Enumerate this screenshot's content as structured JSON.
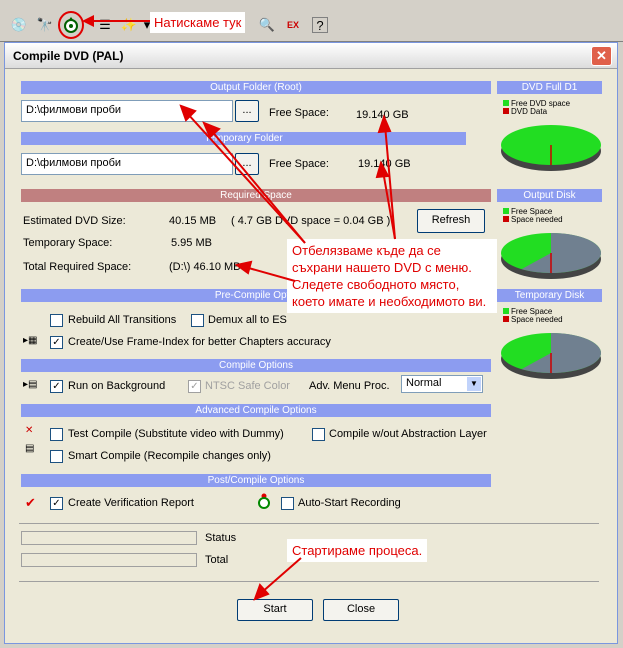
{
  "toolbar": {
    "annotation": "Натискаме тук",
    "icons": [
      "cd-icon",
      "binoculars-icon",
      "dvd-compile-icon",
      "list-icon",
      "magic-icon",
      "dropdown-icon",
      "search-icon",
      "pro-ex-icon",
      "help-icon"
    ]
  },
  "dialog": {
    "title": "Compile DVD (PAL)",
    "output_folder": {
      "band": "Output Folder (Root)",
      "path": "D:\\филмови проби",
      "browse": "...",
      "free_label": "Free Space:",
      "free_value": "19.140 GB"
    },
    "temp_folder": {
      "band": "Temporary Folder",
      "path": "D:\\филмови проби",
      "browse": "...",
      "free_label": "Free Space:",
      "free_value": "19.140 GB"
    },
    "required": {
      "band": "Required Space",
      "est_label": "Estimated DVD Size:",
      "est_value": "40.15 MB",
      "est_note": "( 4.7 GB DVD space = 0.04 GB )",
      "refresh": "Refresh",
      "temp_label": "Temporary Space:",
      "temp_value": "5.95 MB",
      "total_label": "Total Required Space:",
      "total_value": "(D:\\) 46.10 MB"
    },
    "precompile": {
      "band": "Pre-Compile Optio",
      "rebuild": "Rebuild All Transitions",
      "demux": "Demux all to ES",
      "frame_index": "Create/Use Frame-Index for better Chapters accuracy"
    },
    "compile": {
      "band": "Compile Options",
      "run_bg": "Run on Background",
      "ntsc": "NTSC Safe Color",
      "menu_proc_label": "Adv. Menu Proc.",
      "menu_proc_value": "Normal"
    },
    "advanced": {
      "band": "Advanced Compile Options",
      "test": "Test Compile (Substitute video with Dummy)",
      "abstraction": "Compile w/out Abstraction Layer",
      "smart": "Smart Compile (Recompile changes only)"
    },
    "post": {
      "band": "Post/Compile Options",
      "verify": "Create Verification Report",
      "autostart": "Auto-Start Recording"
    },
    "status_label": "Status",
    "total_label": "Total",
    "start": "Start",
    "close": "Close",
    "pies": [
      {
        "title": "DVD Full D1",
        "legend": [
          "Free DVD space",
          "DVD Data"
        ],
        "used_fraction": 0.01
      },
      {
        "title": "Output Disk",
        "legend": [
          "Free Space",
          "Space needed"
        ],
        "used_fraction": 0.6
      },
      {
        "title": "Temporary Disk",
        "legend": [
          "Free Space",
          "Space needed"
        ],
        "used_fraction": 0.6
      }
    ],
    "annotations": {
      "space": "Отбелязваме къде да се съхрани нашето DVD с меню. Следете свободното място, което имате и необходимото ви.",
      "start": "Стартираме процеса."
    },
    "colors": {
      "free": "#22dd22",
      "used": "#708090",
      "needed": "#cc0000",
      "band": "#8c9cf0",
      "arrow": "#e00000"
    }
  }
}
